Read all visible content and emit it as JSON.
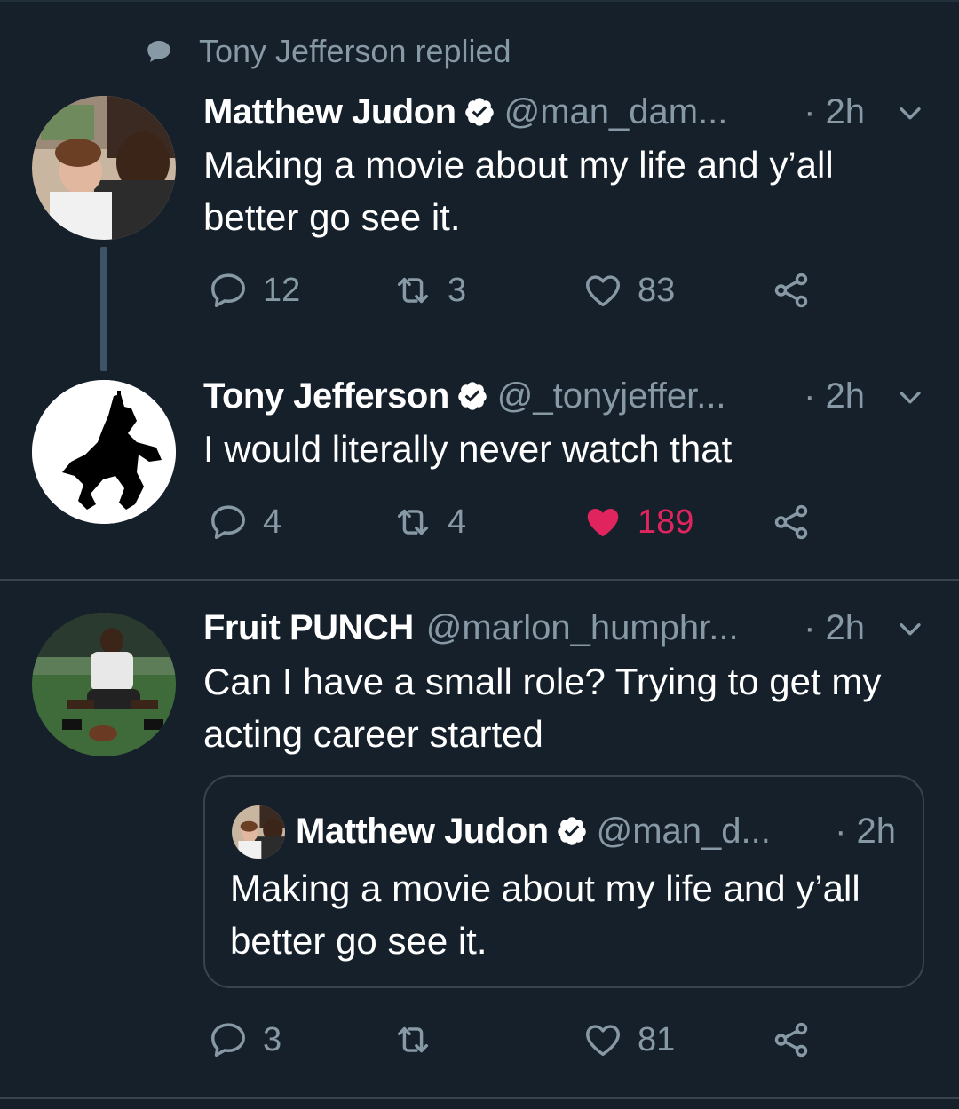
{
  "context": {
    "text": "Tony Jefferson replied",
    "icon": "speech-bubble-icon"
  },
  "colors": {
    "background": "#15202b",
    "secondary_text": "#8899a6",
    "like_red": "#e0245e",
    "verified_blue": "#1da1f2"
  },
  "tweets": [
    {
      "name": "Matthew Judon",
      "verified": true,
      "handle": "@man_dam...",
      "time": "· 2h",
      "text": "Making a movie about my life and y’all better go see it.",
      "replies": "12",
      "retweets": "3",
      "likes": "83",
      "liked": false
    },
    {
      "name": "Tony Jefferson",
      "verified": true,
      "handle": "@_tonyjeffer...",
      "time": "· 2h",
      "text": "I would literally never watch that",
      "replies": "4",
      "retweets": "4",
      "likes": "189",
      "liked": true
    },
    {
      "name": "Fruit PUNCH",
      "verified": false,
      "handle": "@marlon_humphr...",
      "time": "· 2h",
      "text": "Can I have a small role? Trying to get my acting career started",
      "replies": "3",
      "retweets": "",
      "likes": "81",
      "liked": false,
      "quoted": {
        "name": "Matthew Judon",
        "verified": true,
        "handle": "@man_d...",
        "time": "· 2h",
        "text": "Making a movie about my life and y’all better go see it."
      }
    }
  ]
}
